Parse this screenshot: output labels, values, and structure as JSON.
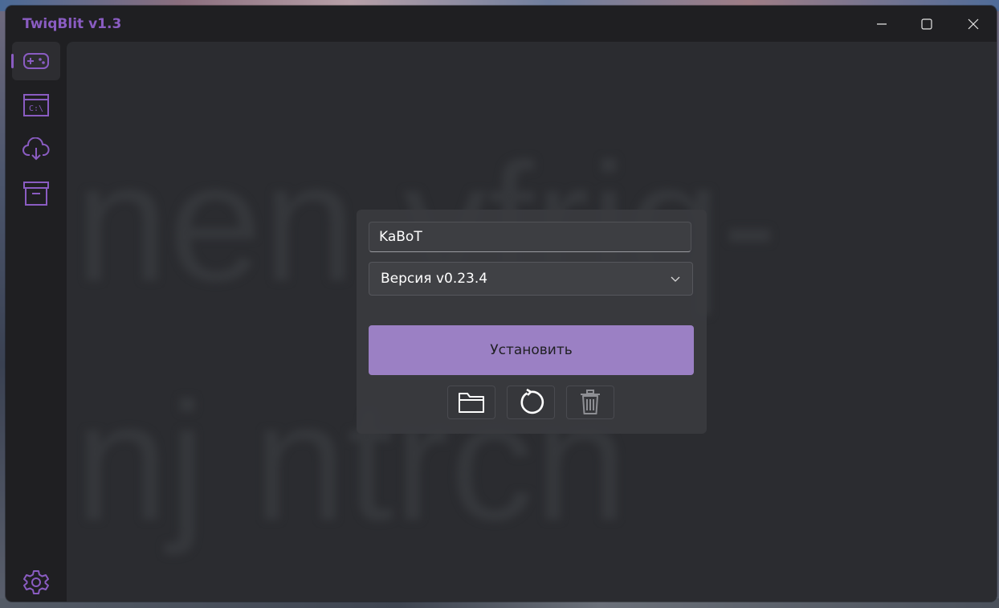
{
  "window": {
    "title": "TwiqBlit v1.3"
  },
  "titlebar_controls": [
    "minimize-icon",
    "maximize-icon",
    "close-icon"
  ],
  "sidebar": {
    "items": [
      {
        "name": "games",
        "icon": "gamepad-icon",
        "active": true
      },
      {
        "name": "console",
        "icon": "terminal-icon",
        "active": false
      },
      {
        "name": "downloads",
        "icon": "cloud-download-icon",
        "active": false
      },
      {
        "name": "archive",
        "icon": "archive-box-icon",
        "active": false
      }
    ],
    "settings_icon": "gear-icon"
  },
  "background_text": {
    "line1": "nen vfriq-",
    "line2": "nj ntrcn"
  },
  "form": {
    "name_value": "KaBoT",
    "version_selected": "Версия v0.23.4",
    "install_label": "Установить",
    "actions": [
      "folder-icon",
      "refresh-icon",
      "trash-icon"
    ]
  },
  "colors": {
    "accent": "#8a5cc2",
    "install_button": "#9b80c4",
    "window_bg": "#1f1f22",
    "content_bg": "#2b2c30"
  }
}
